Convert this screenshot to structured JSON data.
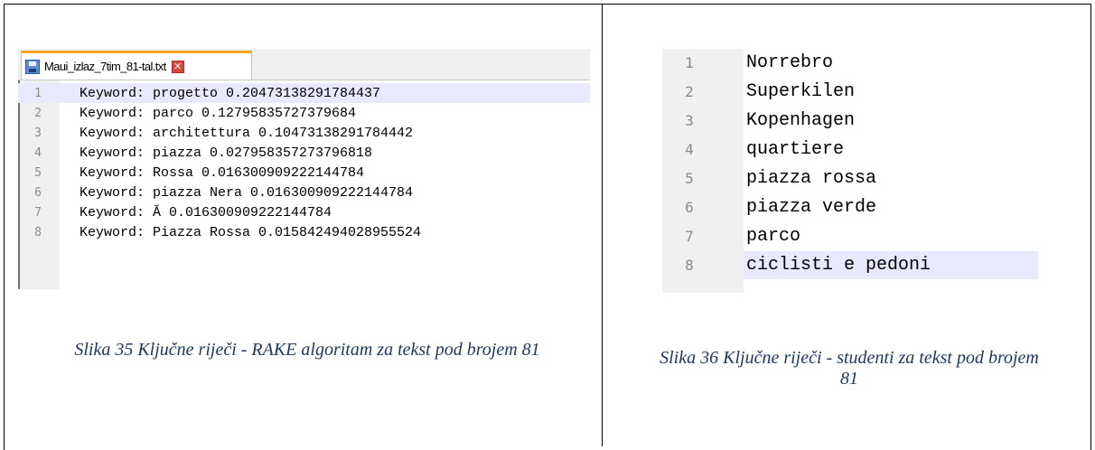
{
  "left_panel": {
    "tab": {
      "filename": "Maui_izlaz_7tim_81-tal.txt",
      "save_icon": "save-icon",
      "close_icon": "close-icon"
    },
    "lines": [
      {
        "num": "1",
        "text": "Keyword: progetto 0.20473138291784437",
        "highlighted": true
      },
      {
        "num": "2",
        "text": "Keyword: parco 0.12795835727379684"
      },
      {
        "num": "3",
        "text": "Keyword: architettura 0.10473138291784442"
      },
      {
        "num": "4",
        "text": "Keyword: piazza 0.027958357273796818"
      },
      {
        "num": "5",
        "text": "Keyword: Rossa 0.016300909222144784"
      },
      {
        "num": "6",
        "text": "Keyword: piazza Nera 0.016300909222144784"
      },
      {
        "num": "7",
        "text": "Keyword: Ă 0.016300909222144784"
      },
      {
        "num": "8",
        "text": "Keyword: Piazza Rossa 0.015842494028955524"
      }
    ],
    "caption": "Slika 35 Ključne riječi - RAKE algoritam za tekst pod brojem 81"
  },
  "right_panel": {
    "lines": [
      {
        "num": "1",
        "text": "Norrebro"
      },
      {
        "num": "2",
        "text": "Superkilen"
      },
      {
        "num": "3",
        "text": "Kopenhagen"
      },
      {
        "num": "4",
        "text": "quartiere"
      },
      {
        "num": "5",
        "text": "piazza rossa"
      },
      {
        "num": "6",
        "text": "piazza verde"
      },
      {
        "num": "7",
        "text": "parco"
      },
      {
        "num": "8",
        "text": "ciclisti e pedoni",
        "highlighted": true
      }
    ],
    "caption_line1": "Slika 36 Ključne riječi - studenti za tekst pod brojem",
    "caption_line2": "81"
  },
  "colors": {
    "caption": "#1f3864",
    "highlight": "#e8e8ff",
    "tab_accent": "#f5a623"
  }
}
